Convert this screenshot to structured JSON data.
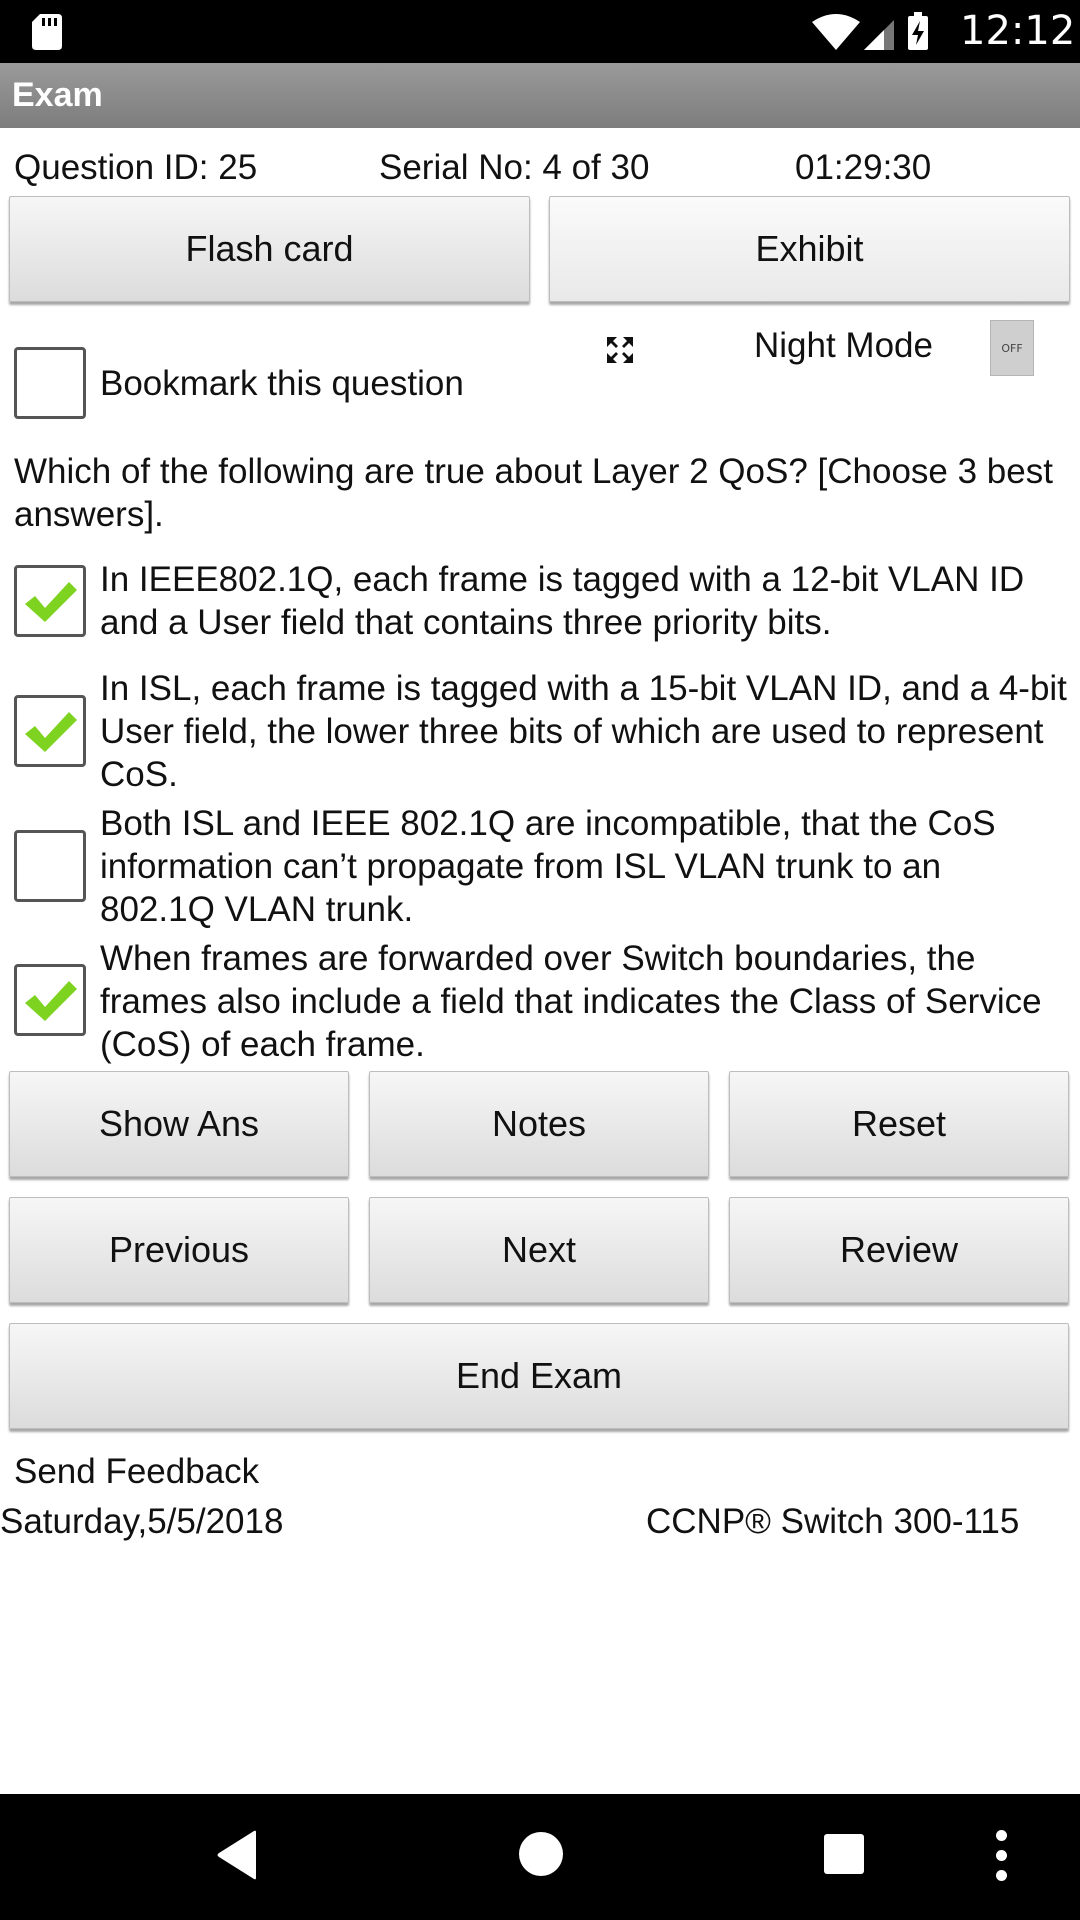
{
  "status_bar": {
    "time": "12:12",
    "sd_icon": "sd-card-icon",
    "wifi_icon": "wifi-icon",
    "signal_icon": "cell-signal-icon",
    "battery_icon": "battery-charging-icon"
  },
  "app_bar": {
    "title": "Exam"
  },
  "info": {
    "question_id": "Question ID: 25",
    "serial": "Serial No: 4 of 30",
    "timer": "01:29:30"
  },
  "top_buttons": {
    "flash_card": "Flash card",
    "exhibit": "Exhibit"
  },
  "bookmark": {
    "label": "Bookmark this question",
    "checked": false
  },
  "night_mode": {
    "label": "Night Mode",
    "toggle": "OFF",
    "expand_icon": "fullscreen-expand-icon"
  },
  "question": {
    "text": "Which of the following are true about Layer 2 QoS? [Choose 3 best answers]."
  },
  "options": [
    {
      "text": "In IEEE802.1Q, each frame is tagged with a 12-bit VLAN ID and a User field that contains three priority bits.",
      "checked": true
    },
    {
      "text": "In ISL, each frame is tagged with a 15-bit VLAN ID, and a 4-bit User field, the lower three bits of which are used to represent CoS.",
      "checked": true
    },
    {
      "text": "Both ISL and IEEE 802.1Q are incompatible, that the CoS information can’t propagate from ISL VLAN trunk to an 802.1Q VLAN trunk.",
      "checked": false
    },
    {
      "text": "When frames are forwarded over Switch boundaries, the frames also include a field that indicates the Class of Service (CoS) of each frame.",
      "checked": true
    }
  ],
  "actions": {
    "show_ans": "Show Ans",
    "notes": "Notes",
    "reset": "Reset",
    "previous": "Previous",
    "next": "Next",
    "review": "Review",
    "end_exam": "End Exam"
  },
  "footer": {
    "feedback": "Send Feedback",
    "date": "Saturday,5/5/2018",
    "exam_name": "CCNP® Switch 300-115"
  },
  "colors": {
    "app_bar": "#8a8a8a",
    "check": "#7ed321",
    "status_bar": "#000000"
  }
}
